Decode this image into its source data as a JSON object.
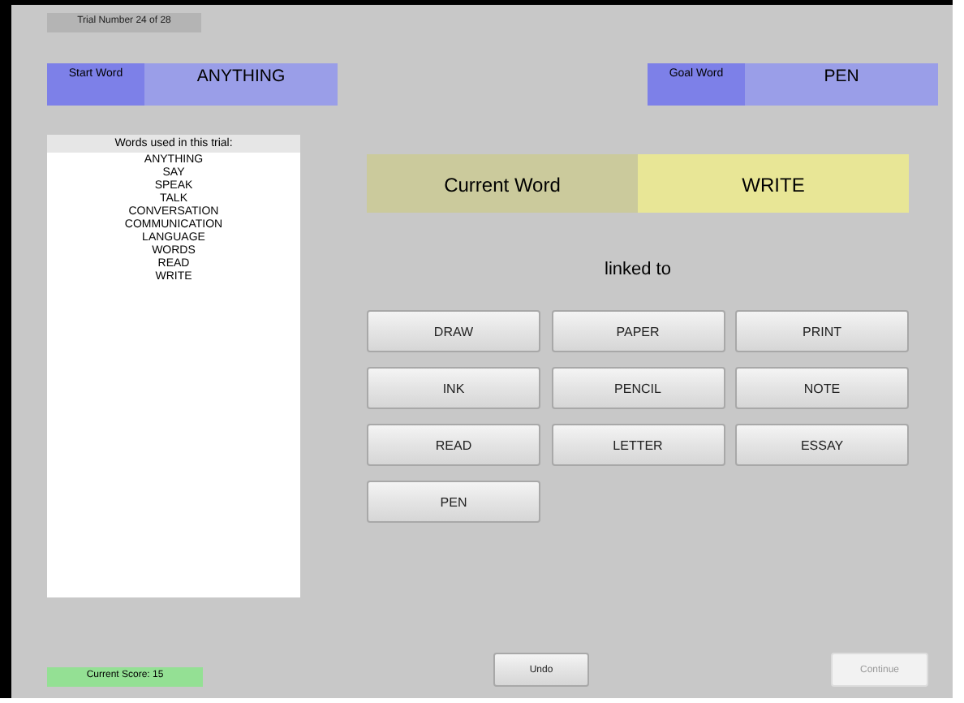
{
  "trial_label": "Trial Number 24 of 28",
  "start": {
    "label": "Start Word",
    "word": "ANYTHING"
  },
  "goal": {
    "label": "Goal Word",
    "word": "PEN"
  },
  "words_panel": {
    "title": "Words used in this trial:",
    "words": [
      "ANYTHING",
      "SAY",
      "SPEAK",
      "TALK",
      "CONVERSATION",
      "COMMUNICATION",
      "LANGUAGE",
      "WORDS",
      "READ",
      "WRITE"
    ]
  },
  "current": {
    "label": "Current Word",
    "word": "WRITE"
  },
  "linked_label": "linked to",
  "choices": [
    "DRAW",
    "PAPER",
    "PRINT",
    "INK",
    "PENCIL",
    "NOTE",
    "READ",
    "LETTER",
    "ESSAY",
    "PEN"
  ],
  "score": "Current Score: 15",
  "buttons": [
    {
      "label": "Undo",
      "disabled": false
    },
    {
      "label": "Continue",
      "disabled": true
    }
  ]
}
